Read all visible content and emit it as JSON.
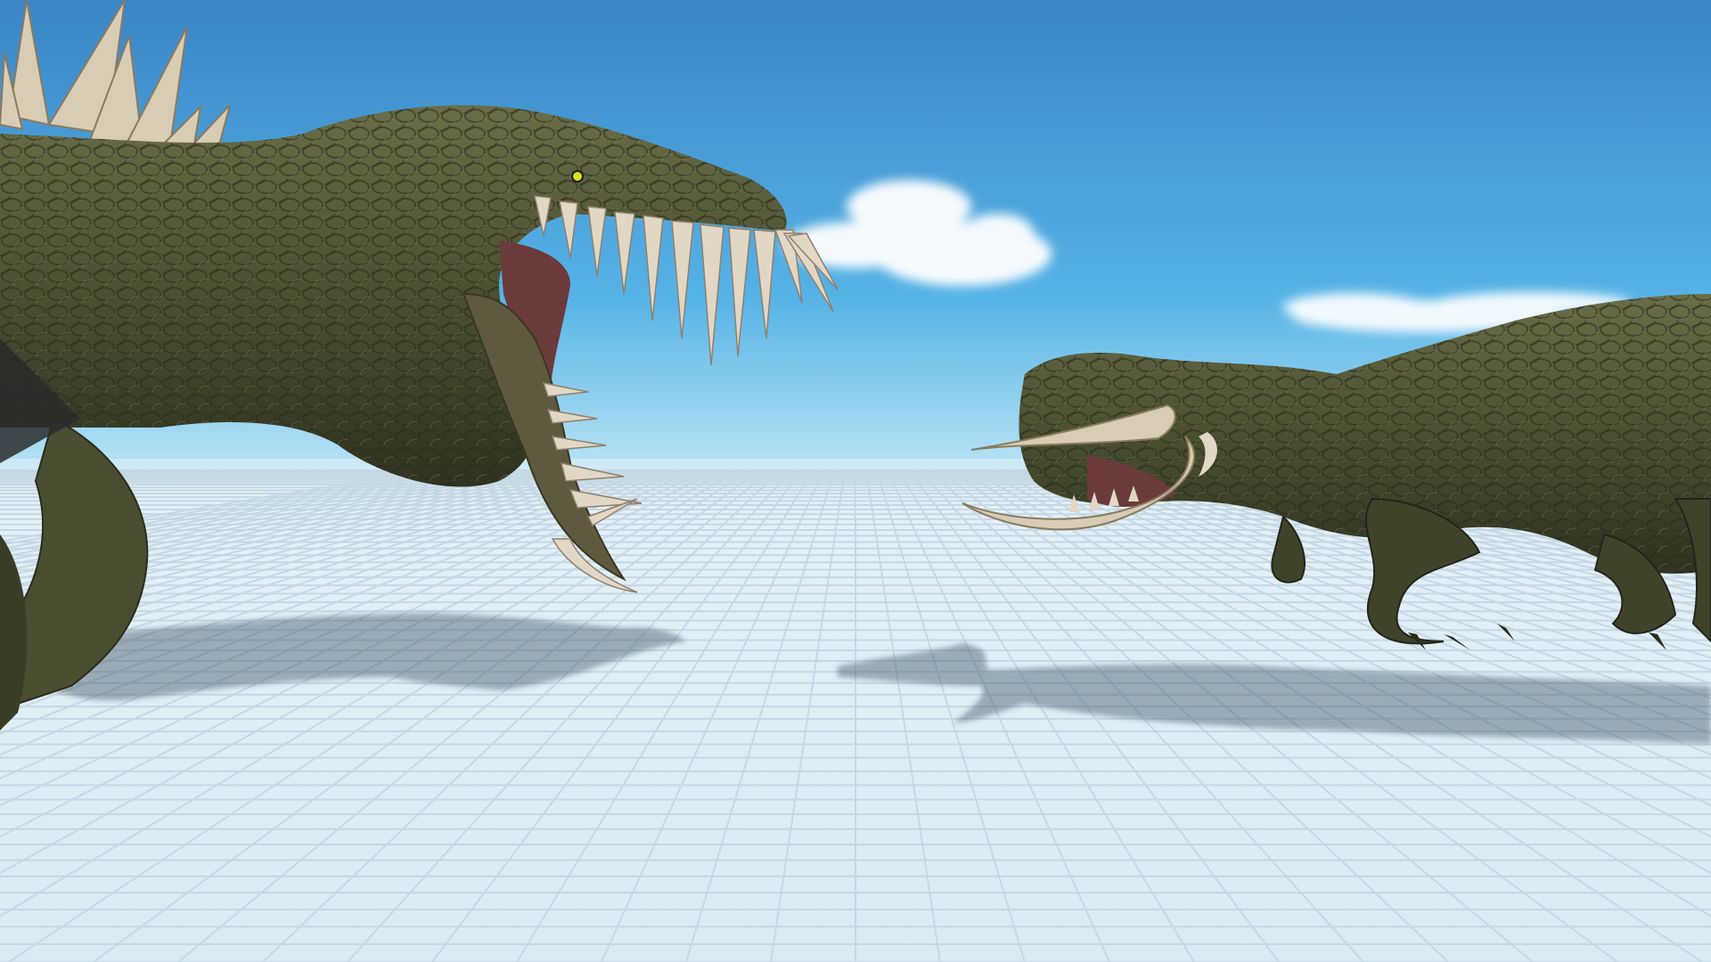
{
  "scene": {
    "sky_top_color": "#3a85c6",
    "sky_mid_color": "#56b3e6",
    "horizon_color": "#bfe7f6",
    "floor_color": "#e4f1f9",
    "grid_line_color": "#c6d8e4",
    "shadow_color": "#3b4d5f",
    "creature_dark_color": "#2f3320",
    "creature_mid_color": "#5b5f3d",
    "creature_light_color": "#8c8c66",
    "tooth_color": "#e2d7c4",
    "mouth_color": "#6b3a3a",
    "eye_color": "#d8e21a"
  },
  "objects": {
    "left_creature": "spiked-dinosaur",
    "right_creature": "tusked-dinosaur",
    "clouds": 2
  }
}
